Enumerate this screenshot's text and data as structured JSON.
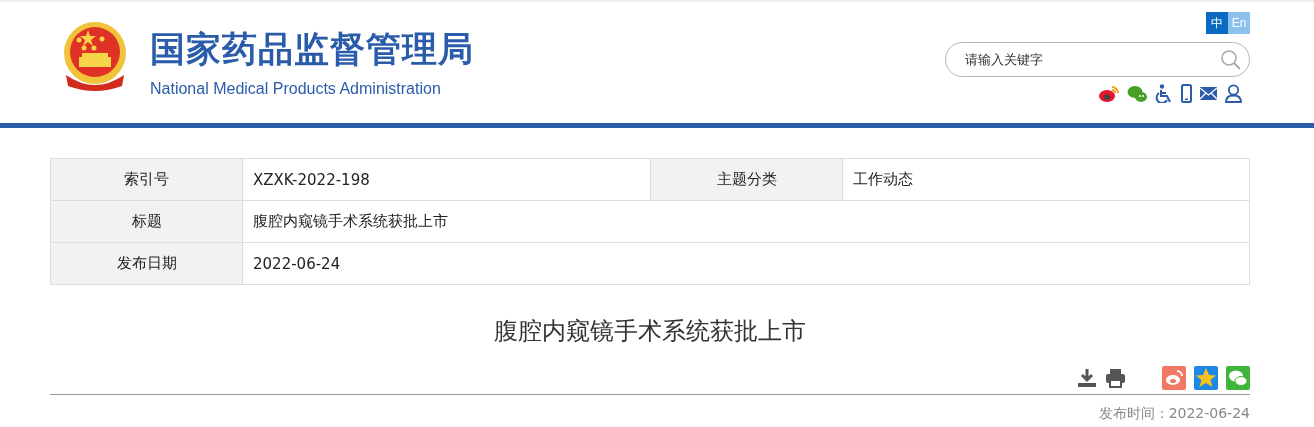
{
  "header": {
    "title": "国家药品监督管理局",
    "subtitle": "National Medical Products Administration",
    "languages": [
      {
        "label": "中",
        "selected": true
      },
      {
        "label": "En",
        "selected": false
      }
    ],
    "search": {
      "placeholder": "请输入关键字"
    }
  },
  "info_table": {
    "rows": [
      {
        "cells": [
          {
            "label": "索引号",
            "value": "XZXK-2022-198"
          },
          {
            "label": "主题分类",
            "value": "工作动态"
          }
        ]
      },
      {
        "cells": [
          {
            "label": "标题",
            "value": "腹腔内窥镜手术系统获批上市"
          }
        ]
      },
      {
        "cells": [
          {
            "label": "发布日期",
            "value": "2022-06-24"
          }
        ]
      }
    ]
  },
  "article": {
    "title": "腹腔内窥镜手术系统获批上市",
    "publish_info": "发布时间：2022-06-24"
  }
}
